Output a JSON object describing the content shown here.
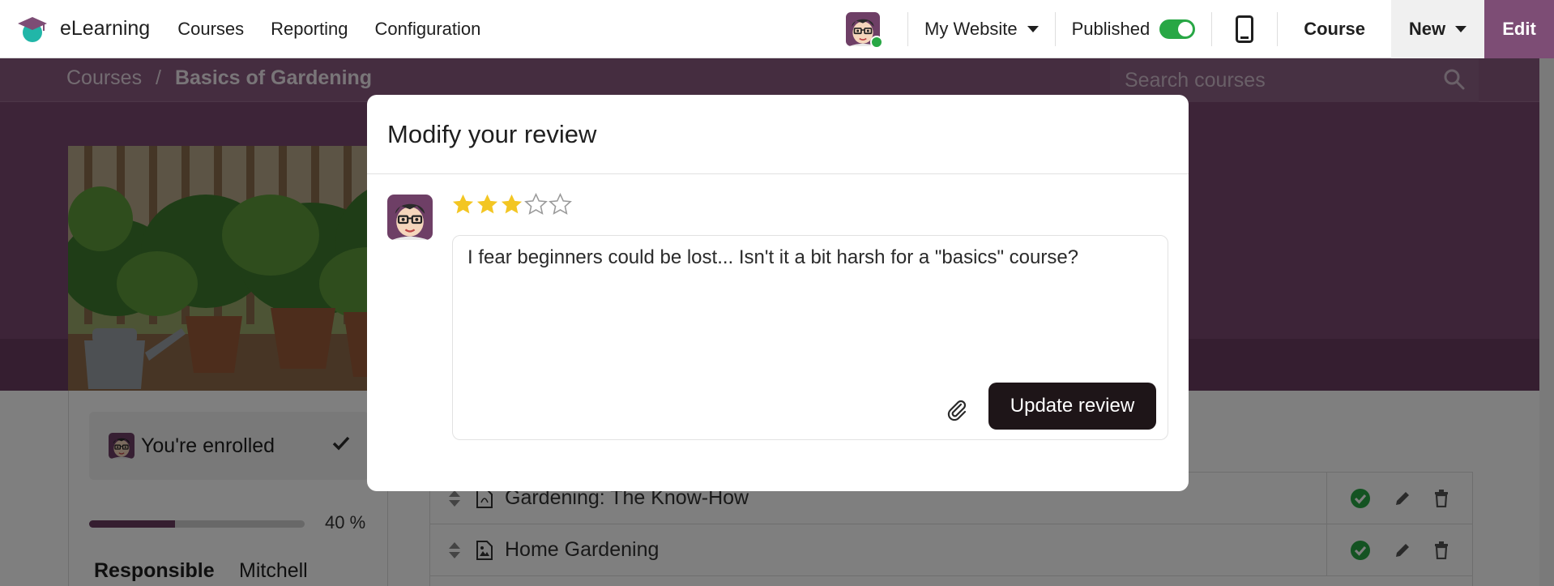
{
  "navbar": {
    "app_name": "eLearning",
    "menu": [
      "Courses",
      "Reporting",
      "Configuration"
    ],
    "website": "My Website",
    "published_label": "Published",
    "published": true,
    "course_label": "Course",
    "new_label": "New",
    "edit_label": "Edit"
  },
  "page": {
    "breadcrumb": {
      "parent": "Courses",
      "separator": "/",
      "current": "Basics of Gardening"
    },
    "search_placeholder": "Search courses",
    "enroll_status": "You're enrolled",
    "progress_percent": 40,
    "progress_label": "40 %",
    "responsible_label": "Responsible",
    "responsible_value": "Mitchell",
    "contents": [
      {
        "title": "Gardening: The Know-How",
        "icon": "pdf-file-icon"
      },
      {
        "title": "Home Gardening",
        "icon": "image-file-icon"
      }
    ]
  },
  "modal": {
    "title": "Modify your review",
    "rating": 3,
    "max_rating": 5,
    "review_text": "I fear beginners could be lost... Isn't it a bit harsh for a \"basics\" course?",
    "submit_label": "Update review"
  },
  "colors": {
    "brand_purple": "#7d4d75",
    "hero_purple": "#7a4870",
    "star_gold": "#f3c623",
    "success_green": "#28a745",
    "button_dark": "#1e1518"
  }
}
